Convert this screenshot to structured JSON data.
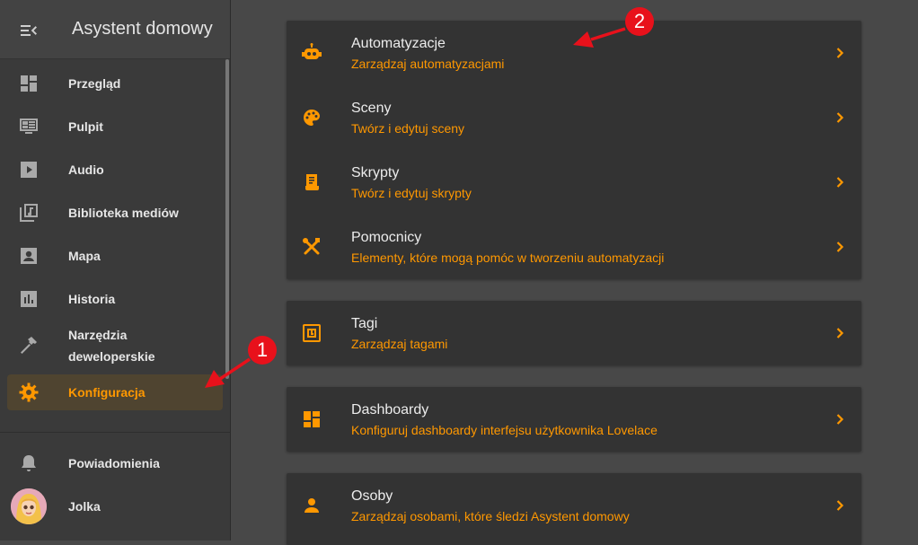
{
  "app": {
    "title": "Asystent domowy"
  },
  "colors": {
    "accent": "#ff9800",
    "annotation_red": "#e8111b"
  },
  "sidebar": {
    "items": [
      {
        "label": "Przegląd",
        "icon": "view-dashboard-icon"
      },
      {
        "label": "Pulpit",
        "icon": "monitor-dashboard-icon"
      },
      {
        "label": "Audio",
        "icon": "play-box-icon"
      },
      {
        "label": "Biblioteka mediów",
        "icon": "music-library-icon"
      },
      {
        "label": "Mapa",
        "icon": "account-box-icon"
      },
      {
        "label": "Historia",
        "icon": "chart-box-icon"
      },
      {
        "label": "Narzędzia deweloperskie",
        "icon": "hammer-icon"
      },
      {
        "label": "Konfiguracja",
        "icon": "gear-icon",
        "active": true
      }
    ],
    "notifications_label": "Powiadomienia",
    "user_name": "Jolka"
  },
  "main": {
    "cards": [
      {
        "rows": [
          {
            "title": "Automatyzacje",
            "subtitle": "Zarządzaj automatyzacjami",
            "icon": "robot-icon"
          },
          {
            "title": "Sceny",
            "subtitle": "Twórz i edytuj sceny",
            "icon": "palette-icon"
          },
          {
            "title": "Skrypty",
            "subtitle": "Twórz i edytuj skrypty",
            "icon": "script-icon"
          },
          {
            "title": "Pomocnicy",
            "subtitle": "Elementy, które mogą pomóc w tworzeniu automatyzacji",
            "icon": "tools-icon"
          }
        ]
      },
      {
        "rows": [
          {
            "title": "Tagi",
            "subtitle": "Zarządzaj tagami",
            "icon": "nfc-tag-icon"
          }
        ]
      },
      {
        "rows": [
          {
            "title": "Dashboardy",
            "subtitle": "Konfiguruj dashboardy interfejsu użytkownika Lovelace",
            "icon": "dashboard-icon"
          }
        ]
      },
      {
        "rows": [
          {
            "title": "Osoby",
            "subtitle": "Zarządzaj osobami, które śledzi Asystent domowy",
            "icon": "account-icon"
          }
        ]
      }
    ]
  },
  "annotations": {
    "badge_1": "1",
    "badge_2": "2"
  }
}
